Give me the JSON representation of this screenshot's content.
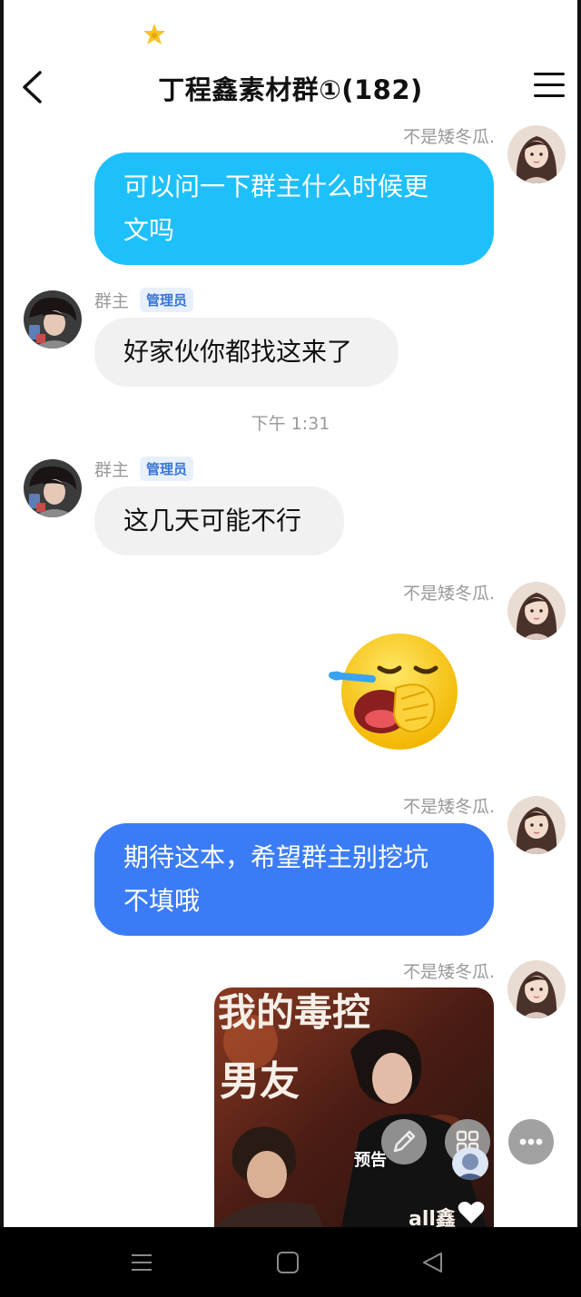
{
  "header": {
    "title": "丁程鑫素材群①(182)"
  },
  "icons": {
    "status": "star-badge-icon",
    "back": "chevron-left-icon",
    "menu": "hamburger-menu-icon",
    "edit": "pencil-icon",
    "apps": "grid-icon",
    "more": "more-dots-icon",
    "like": "heart-icon"
  },
  "colors": {
    "bubble_cyan": "#1ec0fb",
    "bubble_blue": "#3b7cf6",
    "bubble_gray": "#f1f1f1",
    "admin_badge_text": "#3774d6"
  },
  "messages": [
    {
      "sender": "不是矮冬瓜.",
      "side": "right",
      "type": "text",
      "text": "可以问一下群主什么时候更文吗"
    },
    {
      "sender": "群主",
      "badge": "管理员",
      "side": "left",
      "type": "text",
      "text": "好家伙你都找这来了"
    },
    {
      "type": "time",
      "text": "下午 1:31"
    },
    {
      "sender": "群主",
      "badge": "管理员",
      "side": "left",
      "type": "text",
      "text": "这几天可能不行"
    },
    {
      "sender": "不是矮冬瓜.",
      "side": "right",
      "type": "emoji",
      "text": ""
    },
    {
      "sender": "不是矮冬瓜.",
      "side": "right",
      "type": "text",
      "text": "期待这本，希望群主别挖坑不填哦"
    },
    {
      "sender": "不是矮冬瓜.",
      "side": "right",
      "type": "image",
      "text": ""
    }
  ],
  "msg0": {
    "sender": "不是矮冬瓜.",
    "line1": "可以问一下群主什么时候更",
    "line2": "文吗"
  },
  "msg1": {
    "sender": "群主",
    "badge": "管理员",
    "text": "好家伙你都找这来了"
  },
  "time": {
    "text": "下午 1:31"
  },
  "msg2": {
    "sender": "群主",
    "badge": "管理员",
    "text": "这几天可能不行"
  },
  "msg3": {
    "sender": "不是矮冬瓜."
  },
  "msg4": {
    "sender": "不是矮冬瓜.",
    "line1": "期待这本，希望群主别挖坑",
    "line2": "不填哦"
  },
  "msg5": {
    "sender": "不是矮冬瓜.",
    "image_text_1": "我的毒控",
    "image_text_2": "男友",
    "image_text_3": "all鑫"
  },
  "overlay": {
    "preview_label": "预告"
  }
}
